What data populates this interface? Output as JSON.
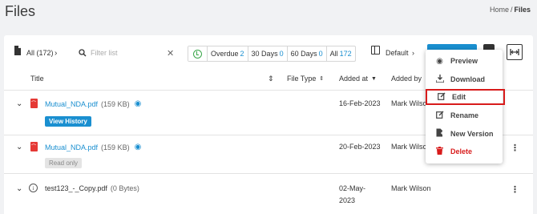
{
  "page": {
    "title": "Files"
  },
  "breadcrumb": {
    "home": "Home",
    "separator": "/",
    "current": "Files"
  },
  "toolbar": {
    "all_label": "All (172)",
    "search_placeholder": "Filter list",
    "filters": [
      {
        "label": "Overdue",
        "count": "2"
      },
      {
        "label": "30 Days",
        "count": "0"
      },
      {
        "label": "60 Days",
        "count": "0"
      },
      {
        "label": "All",
        "count": "172"
      }
    ],
    "view_label": "Default"
  },
  "table": {
    "headers": {
      "title": "Title",
      "file_type": "File Type",
      "added_at": "Added at",
      "added_by": "Added by"
    },
    "rows": [
      {
        "name": "Mutual_NDA.pdf",
        "size": "(159 KB)",
        "added_at": "16-Feb-2023",
        "added_by": "Mark Wilson",
        "badge": "View History"
      },
      {
        "name": "Mutual_NDA.pdf",
        "size": "(159 KB)",
        "added_at": "20-Feb-2023",
        "added_by": "Mark Wilso",
        "badge": "Read only"
      },
      {
        "name": "test123_-_Copy.pdf",
        "size": "(0 Bytes)",
        "added_at_1": "02-May-",
        "added_at_2": "2023",
        "added_by": "Mark Wilson"
      }
    ]
  },
  "menu": {
    "items": [
      {
        "label": "Preview",
        "icon": "eye-icon"
      },
      {
        "label": "Download",
        "icon": "download-icon"
      },
      {
        "label": "Edit",
        "icon": "edit-icon"
      },
      {
        "label": "Rename",
        "icon": "rename-icon"
      },
      {
        "label": "New Version",
        "icon": "new-version-icon"
      },
      {
        "label": "Delete",
        "icon": "trash-icon"
      }
    ]
  },
  "colors": {
    "accent": "#1a8fd0",
    "danger": "#d81b1b",
    "highlight_border": "#d81b1b"
  }
}
